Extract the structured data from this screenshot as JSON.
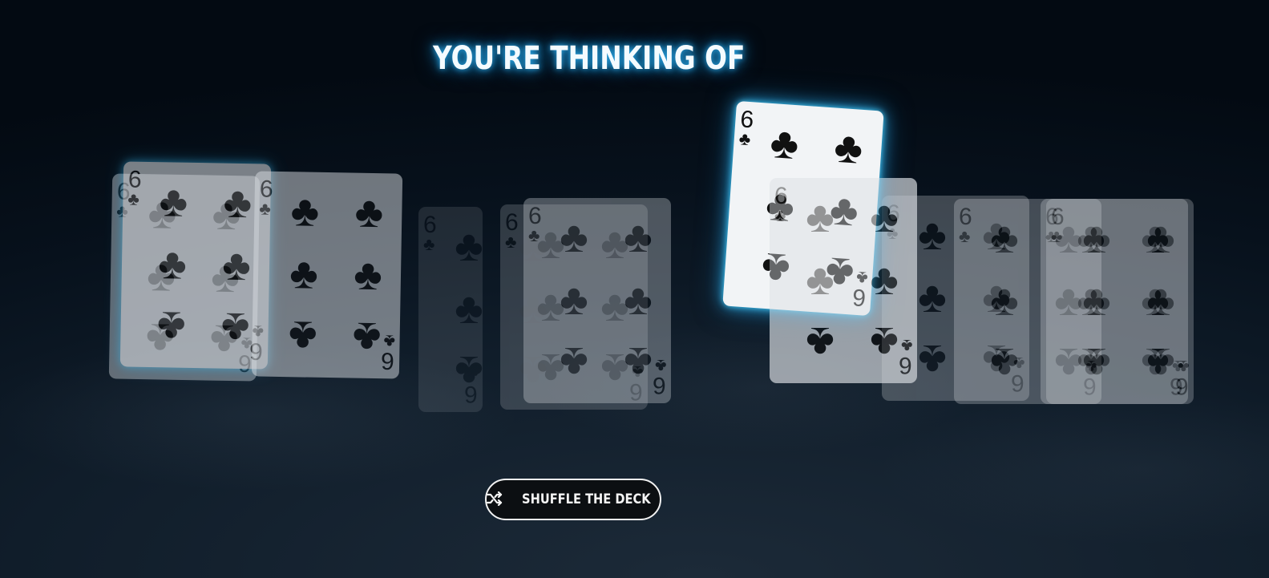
{
  "title": "YOU'RE THINKING OF",
  "card": {
    "rank": "6",
    "suit": "♣",
    "suit_name": "clubs"
  },
  "shuffle_button": {
    "label": "SHUFFLE THE DECK",
    "icon": "shuffle-icon"
  },
  "colors": {
    "glow": "#2aa7e6",
    "background": "#07111c",
    "button_bg": "#0c0f12"
  }
}
